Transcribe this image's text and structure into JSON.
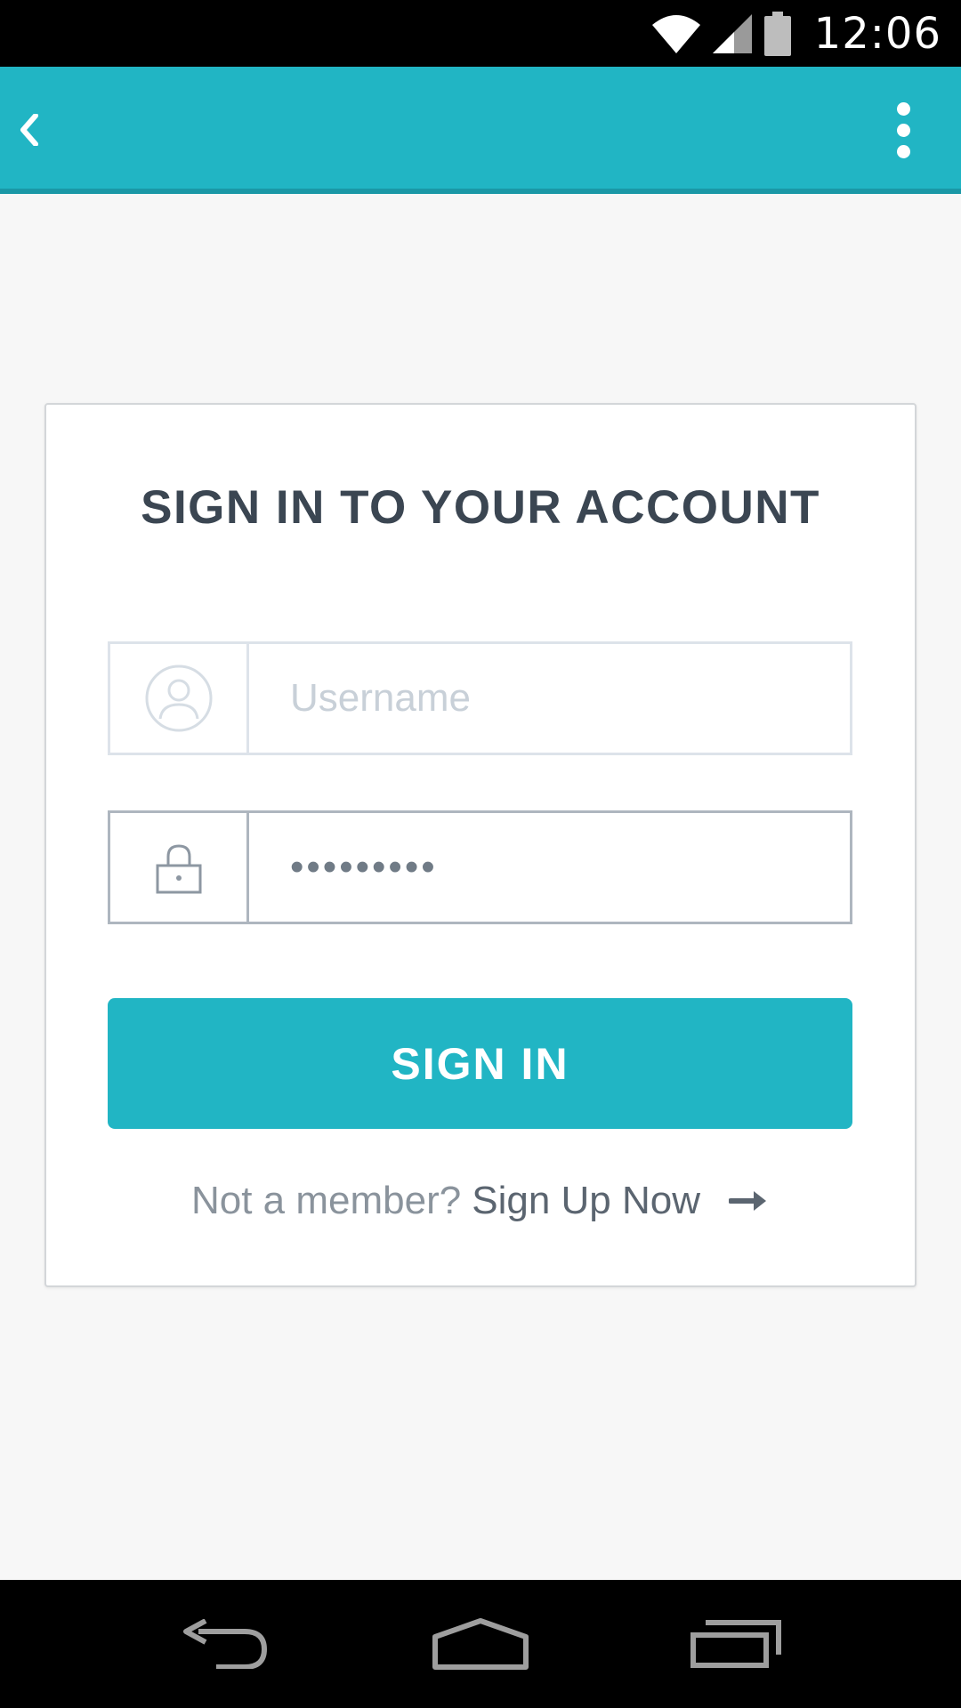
{
  "status_bar": {
    "time": "12:06",
    "icons": [
      "wifi-icon",
      "signal-icon",
      "battery-icon"
    ]
  },
  "app_bar": {
    "color": "#21b5c4",
    "back_icon": "chevron-left-icon",
    "menu_icon": "overflow-menu-icon"
  },
  "login": {
    "title": "SIGN IN TO YOUR ACCOUNT",
    "username": {
      "placeholder": "Username",
      "value": "",
      "icon": "user-icon"
    },
    "password": {
      "value": "•••••••••",
      "icon": "lock-icon"
    },
    "submit_label": "SIGN IN",
    "signup_prompt": "Not a member?",
    "signup_link": "Sign Up Now",
    "signup_icon": "arrow-right-icon",
    "accent_color": "#21b5c4"
  },
  "nav_bar": {
    "buttons": [
      "back-nav-icon",
      "home-nav-icon",
      "recents-nav-icon"
    ]
  }
}
